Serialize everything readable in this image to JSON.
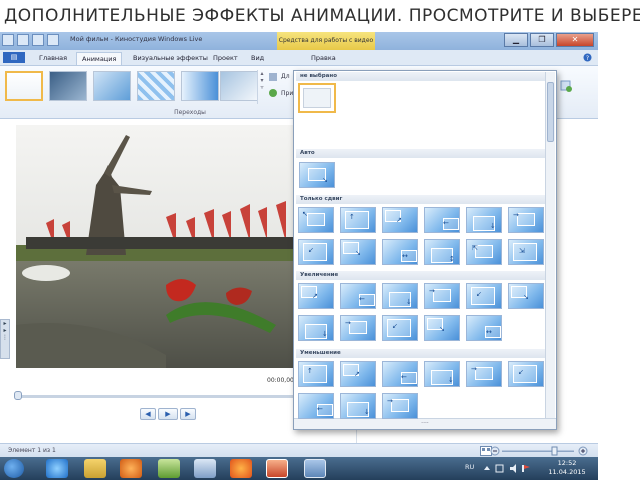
{
  "slide": {
    "title": "ДОПОЛНИТЕЛЬНЫЕ ЭФФЕКТЫ АНИМАЦИИ. ПРОСМОТРИТЕ И ВЫБЕРЕТЕ…"
  },
  "window": {
    "title": "Мой фильм - Киностудия Windows Live",
    "tools_context": "Средства для работы с видео",
    "minimize": "▁",
    "maximize": "❐",
    "close": "✕"
  },
  "tabs": {
    "app_button": "▤",
    "items": [
      "Главная",
      "Анимация",
      "Визуальные эффекты",
      "Проект",
      "Вид",
      "Правка"
    ],
    "active": "Анимация"
  },
  "ribbon": {
    "group_label": "Переходы",
    "duration_label": "Дл",
    "apply_label": "При"
  },
  "player": {
    "timecode": "00:00,00",
    "prev": "◀",
    "play": "▶",
    "next": "▶"
  },
  "gallery": {
    "sections": {
      "none": "не выбрано",
      "auto": "Авто",
      "pan_only": "Только сдвиг",
      "zoom_in": "Увеличение",
      "zoom_out": "Уменьшение"
    },
    "grip": "····"
  },
  "status": {
    "text": "Элемент 1 из 1"
  },
  "taskbar": {
    "lang": "RU",
    "time": "12:52",
    "date": "11.04.2015"
  },
  "colors": {
    "accent": "#2f67c0",
    "tools_tab": "#e8c948",
    "selection": "#f0b94a",
    "taskbar": "#243f5b"
  }
}
